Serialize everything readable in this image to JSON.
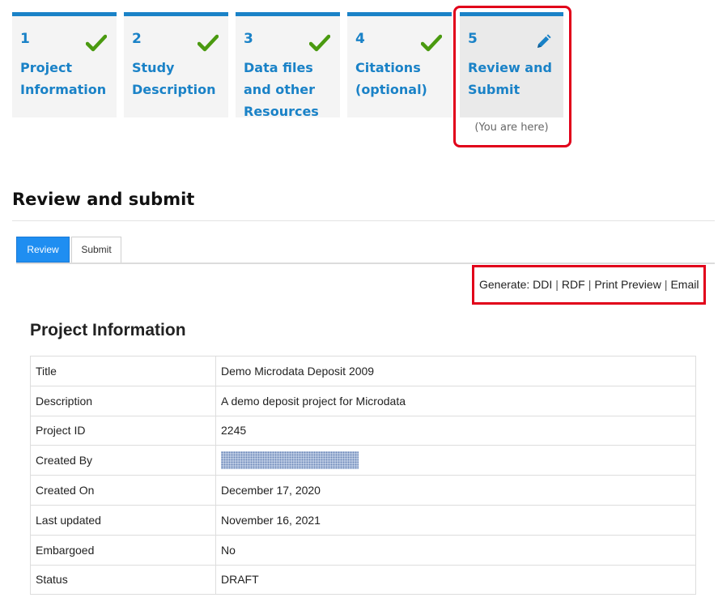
{
  "steps": [
    {
      "number": "1",
      "label": "Project Information",
      "status": "complete",
      "icon": "check-icon"
    },
    {
      "number": "2",
      "label": "Study Description",
      "status": "complete",
      "icon": "check-icon"
    },
    {
      "number": "3",
      "label": "Data files and other Resources",
      "status": "complete",
      "icon": "check-icon"
    },
    {
      "number": "4",
      "label": "Citations (optional)",
      "status": "complete",
      "icon": "check-icon"
    },
    {
      "number": "5",
      "label": "Review and Submit",
      "status": "current",
      "icon": "pencil-icon",
      "here_text": "(You are here)"
    }
  ],
  "section_title": "Review and submit",
  "tabs": {
    "review": "Review",
    "submit": "Submit",
    "active": "Review"
  },
  "generate": {
    "label": "Generate:",
    "links": [
      "DDI",
      "RDF",
      "Print Preview",
      "Email"
    ]
  },
  "project_info": {
    "title": "Project Information",
    "rows": [
      {
        "key": "Title",
        "value": "Demo Microdata Deposit 2009"
      },
      {
        "key": "Description",
        "value": "A demo deposit project for Microdata"
      },
      {
        "key": "Project ID",
        "value": "2245"
      },
      {
        "key": "Created By",
        "value": ""
      },
      {
        "key": "Created On",
        "value": "December 17, 2020"
      },
      {
        "key": "Last updated",
        "value": "November 16, 2021"
      },
      {
        "key": "Embargoed",
        "value": "No"
      },
      {
        "key": "Status",
        "value": "DRAFT"
      }
    ]
  },
  "colors": {
    "accent": "#1a82c7",
    "check": "#4a9a10",
    "highlight": "#e1001a",
    "tab_active": "#1f8ef1"
  }
}
